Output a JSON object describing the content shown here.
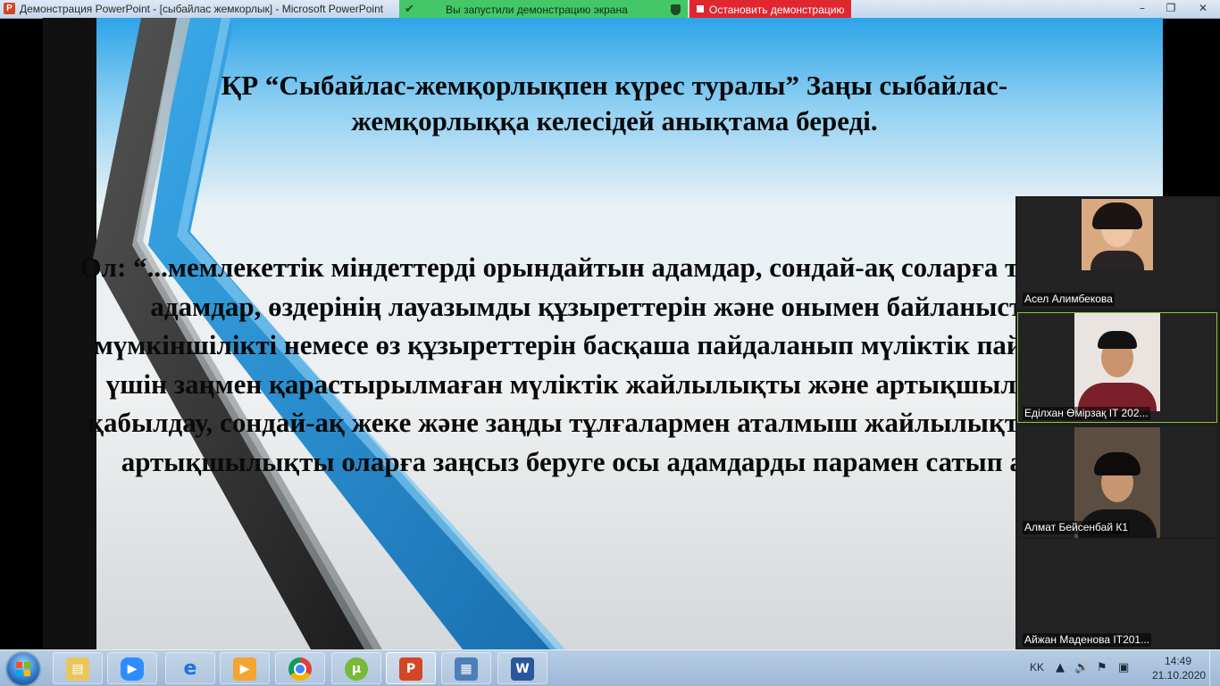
{
  "window": {
    "title": "Демонстрация PowerPoint - [сыбайлас жемкорлык] - Microsoft PowerPoint",
    "app_icon": "powerpoint-icon",
    "controls": [
      "minimize-icon",
      "restore-icon",
      "close-icon"
    ]
  },
  "share_banner": {
    "status_text": "Вы запустили демонстрацию экрана",
    "color": "#44c767",
    "stop_label": "Остановить демонстрацию",
    "stop_color": "#e0262f"
  },
  "slide": {
    "title": "ҚР “Сыбайлас-жемқорлықпен күрес туралы” Заңы сыбайлас-жемқорлыққа келесідей анықтама береді.",
    "body": "Ол: “...мемлекеттік міндеттерді орындайтын адамдар, сондай-ақ соларға теңелген адамдар, өздерінің лауазымды құзыреттерін және онымен байланысты мүмкіншілікті немесе өз құзыреттерін басқаша пайдаланып мүліктік пайда алу үшін заңмен қарастырылмаған мүліктік жайлылықты және артықшылықты қабылдау, сондай-ақ жеке және заңды тұлғалармен аталмыш жайлылықты және артықшылықты оларға заңсыз беруге осы адамдарды парамен сатып алу”.",
    "accent_color": "#2ea4e8"
  },
  "participants": [
    {
      "name": "Асел Алимбекова",
      "active": false
    },
    {
      "name": "Еділхан Өмірзақ IT 202...",
      "active": true
    },
    {
      "name": "Алмат Бейсенбай К1",
      "active": false
    },
    {
      "name": "Айжан Маденова IT201...",
      "active": false
    }
  ],
  "taskbar": {
    "apps": [
      {
        "name": "explorer",
        "icon": "folder-icon"
      },
      {
        "name": "zoom",
        "icon": "zoom-icon"
      },
      {
        "name": "internet-explorer",
        "icon": "ie-icon"
      },
      {
        "name": "media-player",
        "icon": "media-icon"
      },
      {
        "name": "chrome",
        "icon": "chrome-icon"
      },
      {
        "name": "utorrent",
        "icon": "utorrent-icon"
      },
      {
        "name": "powerpoint",
        "icon": "powerpoint-icon"
      },
      {
        "name": "control-panel",
        "icon": "control-panel-icon"
      },
      {
        "name": "word",
        "icon": "word-icon"
      }
    ],
    "language": "KK",
    "time": "14:49",
    "date": "21.10.2020"
  }
}
